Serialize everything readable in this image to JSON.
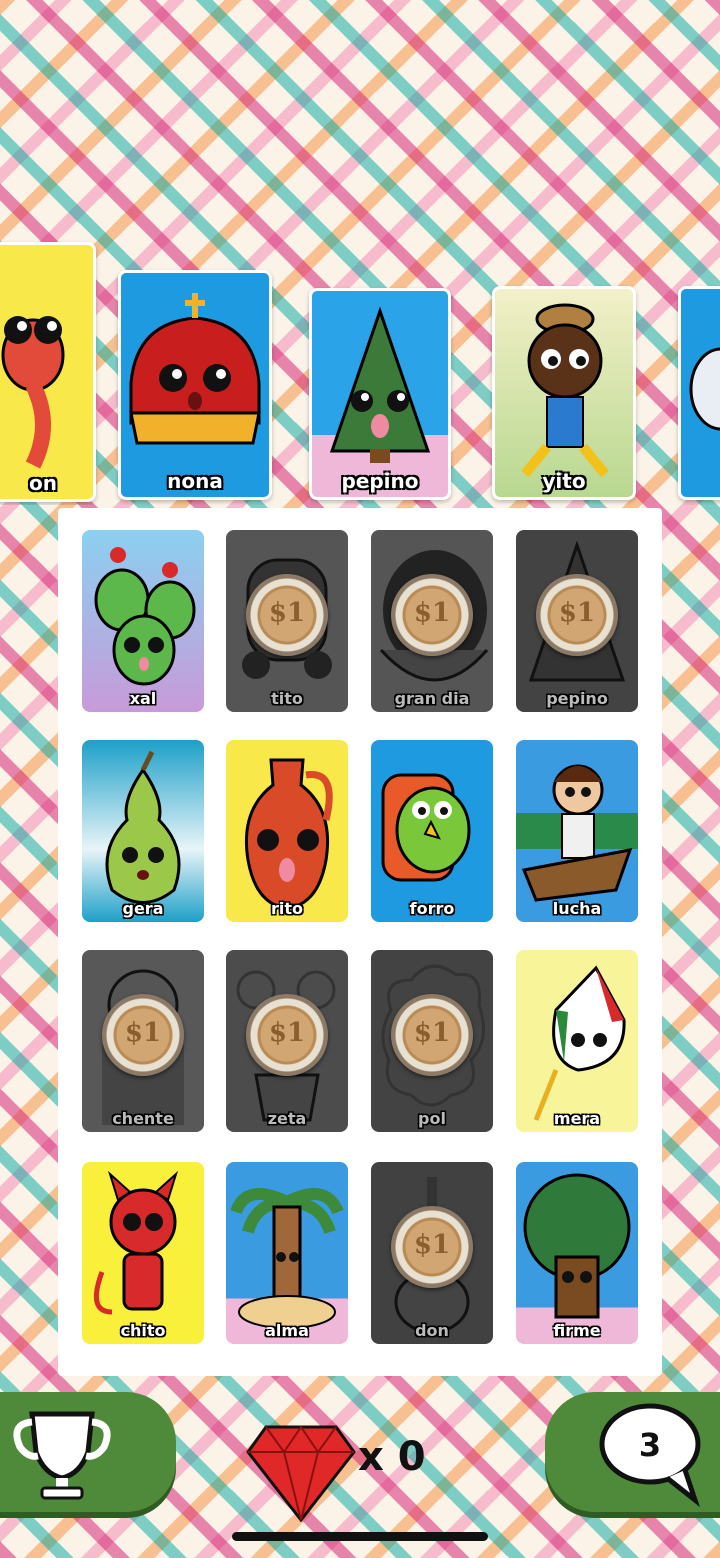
{
  "called_cards": [
    {
      "label": "on",
      "bg": "#f8e84a"
    },
    {
      "label": "nona",
      "bg": "#1e9be0"
    },
    {
      "label": "pepino",
      "bg": "#2aa3e8"
    },
    {
      "label": "yito",
      "bg": "#f3f0c8"
    },
    {
      "label": "",
      "bg": "#1e9be0"
    }
  ],
  "board": {
    "cards": [
      {
        "label": "xal",
        "bg": "#8bd0f0",
        "marked": false,
        "art": "cactus-icon"
      },
      {
        "label": "tito",
        "bg": "#9a9a9a",
        "marked": true,
        "art": "cannon-icon"
      },
      {
        "label": "gran dia",
        "bg": "#9a9a9a",
        "marked": true,
        "art": "hat-icon"
      },
      {
        "label": "pepino",
        "bg": "#9a9a9a",
        "marked": true,
        "art": "tree-icon"
      },
      {
        "label": "gera",
        "bg": "#1da0c8",
        "marked": false,
        "art": "pear-icon"
      },
      {
        "label": "rito",
        "bg": "#f8e84a",
        "marked": false,
        "art": "jug-icon"
      },
      {
        "label": "forro",
        "bg": "#1e9be0",
        "marked": false,
        "art": "parrot-icon"
      },
      {
        "label": "lucha",
        "bg": "#3a9be0",
        "marked": false,
        "art": "girl-canoe-icon"
      },
      {
        "label": "chente",
        "bg": "#9a9a9a",
        "marked": true,
        "art": "man-icon"
      },
      {
        "label": "zeta",
        "bg": "#9a9a9a",
        "marked": true,
        "art": "pot-icon"
      },
      {
        "label": "pol",
        "bg": "#9a9a9a",
        "marked": true,
        "art": "cloud-icon"
      },
      {
        "label": "mera",
        "bg": "#f8f49a",
        "marked": false,
        "art": "flag-icon"
      },
      {
        "label": "chito",
        "bg": "#f8f03a",
        "marked": false,
        "art": "devil-icon"
      },
      {
        "label": "alma",
        "bg": "#3a9be0",
        "marked": false,
        "art": "palm-icon"
      },
      {
        "label": "don",
        "bg": "#9a9a9a",
        "marked": true,
        "art": "guitar-icon"
      },
      {
        "label": "firme",
        "bg": "#3a9be0",
        "marked": false,
        "art": "oak-icon"
      }
    ],
    "coin_glyph": "$1"
  },
  "bottom_bar": {
    "gem_count": "x 0",
    "chat_badge": "3"
  },
  "colors": {
    "button_green": "#4f8a3a",
    "gem_red": "#e02828"
  }
}
